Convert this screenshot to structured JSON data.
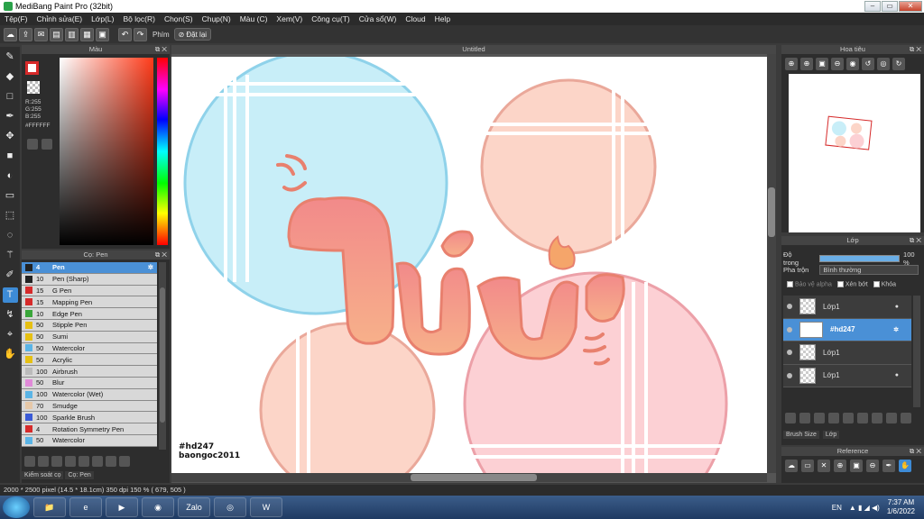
{
  "window": {
    "title": "MediBang Paint Pro (32bit)"
  },
  "menu": [
    "Tệp(F)",
    "Chỉnh sửa(E)",
    "Lớp(L)",
    "Bộ lọc(R)",
    "Chọn(S)",
    "Chụp(N)",
    "Màu (C)",
    "Xem(V)",
    "Công cụ(T)",
    "Cửa sổ(W)",
    "Cloud",
    "Help"
  ],
  "toolbar": {
    "shortcut_label": "Phím",
    "reset_label": "Đặt lại"
  },
  "color_panel": {
    "title": "Màu",
    "rgb": [
      "R:255",
      "G:255",
      "B:255"
    ],
    "hex": "#FFFFFF",
    "colors": {
      "foreground_border": "#d62a2a",
      "sv_hue": "#ff3b1a"
    }
  },
  "brush_panel": {
    "title": "Cọ: Pen",
    "brushes": [
      {
        "size": "4",
        "name": "Pen",
        "color": "#222222"
      },
      {
        "size": "10",
        "name": "Pen (Sharp)",
        "color": "#222222"
      },
      {
        "size": "15",
        "name": "G Pen",
        "color": "#d62a2a"
      },
      {
        "size": "15",
        "name": "Mapping Pen",
        "color": "#d62a2a"
      },
      {
        "size": "10",
        "name": "Edge Pen",
        "color": "#3aa63a"
      },
      {
        "size": "50",
        "name": "Stipple Pen",
        "color": "#e6c012"
      },
      {
        "size": "50",
        "name": "Sumi",
        "color": "#e6c012"
      },
      {
        "size": "50",
        "name": "Watercolor",
        "color": "#5ab4e6"
      },
      {
        "size": "50",
        "name": "Acrylic",
        "color": "#e6c012"
      },
      {
        "size": "100",
        "name": "Airbrush",
        "color": "#bbbbbb"
      },
      {
        "size": "50",
        "name": "Blur",
        "color": "#e08ad8"
      },
      {
        "size": "100",
        "name": "Watercolor (Wet)",
        "color": "#5ab4e6"
      },
      {
        "size": "70",
        "name": "Smudge",
        "color": "#e6c8a8"
      },
      {
        "size": "100",
        "name": "Sparkle Brush",
        "color": "#3a5ad6"
      },
      {
        "size": "4",
        "name": "Rotation Symmetry Pen",
        "color": "#d62a2a"
      },
      {
        "size": "50",
        "name": "Watercolor",
        "color": "#5ab4e6"
      }
    ],
    "tabs": [
      "Kiểm soát cọ",
      "Cọ: Pen"
    ]
  },
  "canvas": {
    "title": "Untitled",
    "signature_lines": [
      "#hd247",
      "baongoc2011"
    ]
  },
  "navigator": {
    "title": "Hoa tiêu"
  },
  "layer_panel": {
    "title": "Lớp",
    "opacity_label": "Độ trong",
    "opacity_value": "100 %",
    "opacity_fraction": 1.0,
    "blend_label": "Pha trộn",
    "blend_value": "Bình thường",
    "protect_alpha": "Bảo vệ alpha",
    "clipping": "Xén bớt",
    "lock": "Khóa",
    "layers": [
      {
        "name": "Lớp1",
        "selected": false
      },
      {
        "name": "#hd247",
        "selected": true
      },
      {
        "name": "Lớp1",
        "selected": false
      },
      {
        "name": "Lớp1",
        "selected": false
      }
    ],
    "tabs": [
      "Brush Size",
      "Lớp"
    ]
  },
  "reference_panel": {
    "title": "Reference"
  },
  "status": {
    "text": "2000 * 2500 pixel  (14.5 * 18.1cm)  350 dpi  150 %  ( 679, 505 )"
  },
  "taskbar": {
    "apps": [
      "folder",
      "ie",
      "media",
      "browser",
      "Zalo",
      "chrome",
      "W"
    ],
    "lang": "EN",
    "time": "7:37 AM",
    "date": "1/6/2022"
  }
}
